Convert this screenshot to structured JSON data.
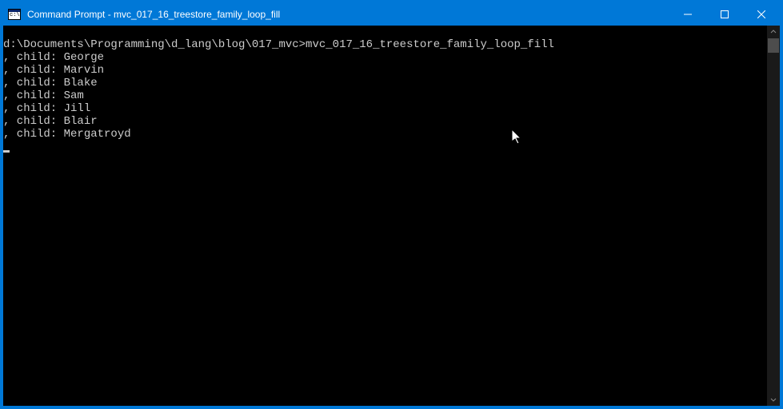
{
  "window": {
    "title": "Command Prompt - mvc_017_16_treestore_family_loop_fill"
  },
  "console": {
    "prompt_line": "d:\\Documents\\Programming\\d_lang\\blog\\017_mvc>mvc_017_16_treestore_family_loop_fill",
    "output_lines": [
      ", child: George",
      ", child: Marvin",
      ", child: Blake",
      ", child: Sam",
      ", child: Jill",
      ", child: Blair",
      ", child: Mergatroyd"
    ]
  }
}
